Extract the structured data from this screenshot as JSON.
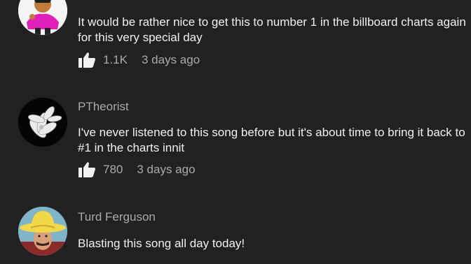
{
  "comments": [
    {
      "author": "",
      "text": "It would be rather nice to get this to number 1 in the billboard charts again for this very special day",
      "likes": "1.1K",
      "time": "3 days ago"
    },
    {
      "author": "PTheorist",
      "text": "I've never listened to this song before but it's about time to bring it back to #1 in the charts innit",
      "likes": "780",
      "time": "3 days ago"
    },
    {
      "author": "Turd Ferguson",
      "text": "Blasting this song all day today!"
    }
  ],
  "icons": {
    "like": "thumbs-up-icon"
  },
  "colors": {
    "background": "#212121",
    "primary_text": "#f1f1f1",
    "secondary_text": "#aaaaaa"
  }
}
